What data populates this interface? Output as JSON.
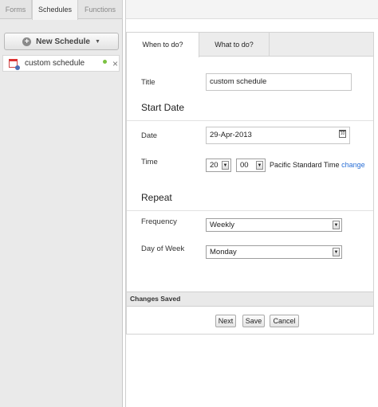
{
  "sidebar": {
    "tabs": [
      {
        "label": "Forms"
      },
      {
        "label": "Schedules"
      },
      {
        "label": "Functions"
      }
    ],
    "new_button": {
      "label": "New Schedule"
    },
    "items": [
      {
        "label": "custom schedule",
        "status_color": "#7bc241"
      }
    ]
  },
  "wizard": {
    "tabs": [
      {
        "label": "When to do?"
      },
      {
        "label": "What to do?"
      }
    ],
    "title": {
      "label": "Title",
      "value": "custom schedule"
    },
    "start_date": {
      "heading": "Start Date",
      "date_label": "Date",
      "date_value": "29-Apr-2013",
      "time_label": "Time",
      "hour": "20",
      "minute": "00",
      "timezone": "Pacific Standard Time",
      "change_link": "change"
    },
    "repeat": {
      "heading": "Repeat",
      "frequency_label": "Frequency",
      "frequency_value": "Weekly",
      "day_label": "Day of Week",
      "day_value": "Monday"
    },
    "status": "Changes Saved",
    "buttons": {
      "next": "Next",
      "save": "Save",
      "cancel": "Cancel"
    }
  },
  "icons": {
    "new": "plus-circle-icon",
    "item": "calendar-icon",
    "remove": "close-icon",
    "date_picker": "calendar-icon",
    "dropdown": "chevron-down-icon"
  },
  "colors": {
    "link": "#2a6fd6",
    "status_ok": "#7bc241"
  }
}
